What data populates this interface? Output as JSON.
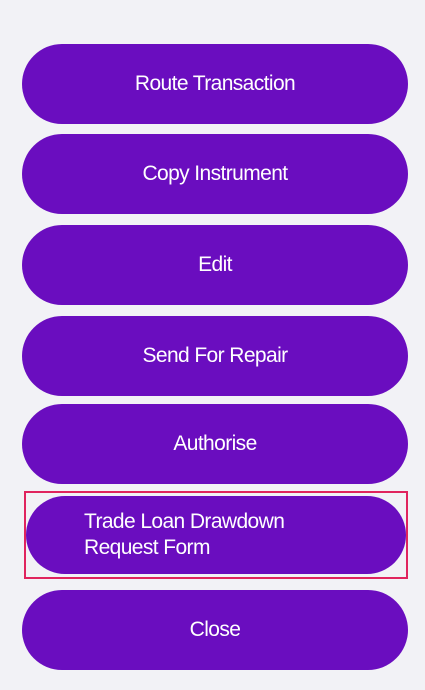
{
  "actions": {
    "route_transaction": "Route Transaction",
    "copy_instrument": "Copy Instrument",
    "edit": "Edit",
    "send_for_repair": "Send For Repair",
    "authorise": "Authorise",
    "trade_loan_drawdown": "Trade Loan Drawdown\nRequest Form",
    "close": "Close"
  },
  "colors": {
    "button_bg": "#6a0dbf",
    "button_text": "#ffffff",
    "highlight_border": "#e0245e",
    "panel_bg": "#f2f2f6"
  }
}
